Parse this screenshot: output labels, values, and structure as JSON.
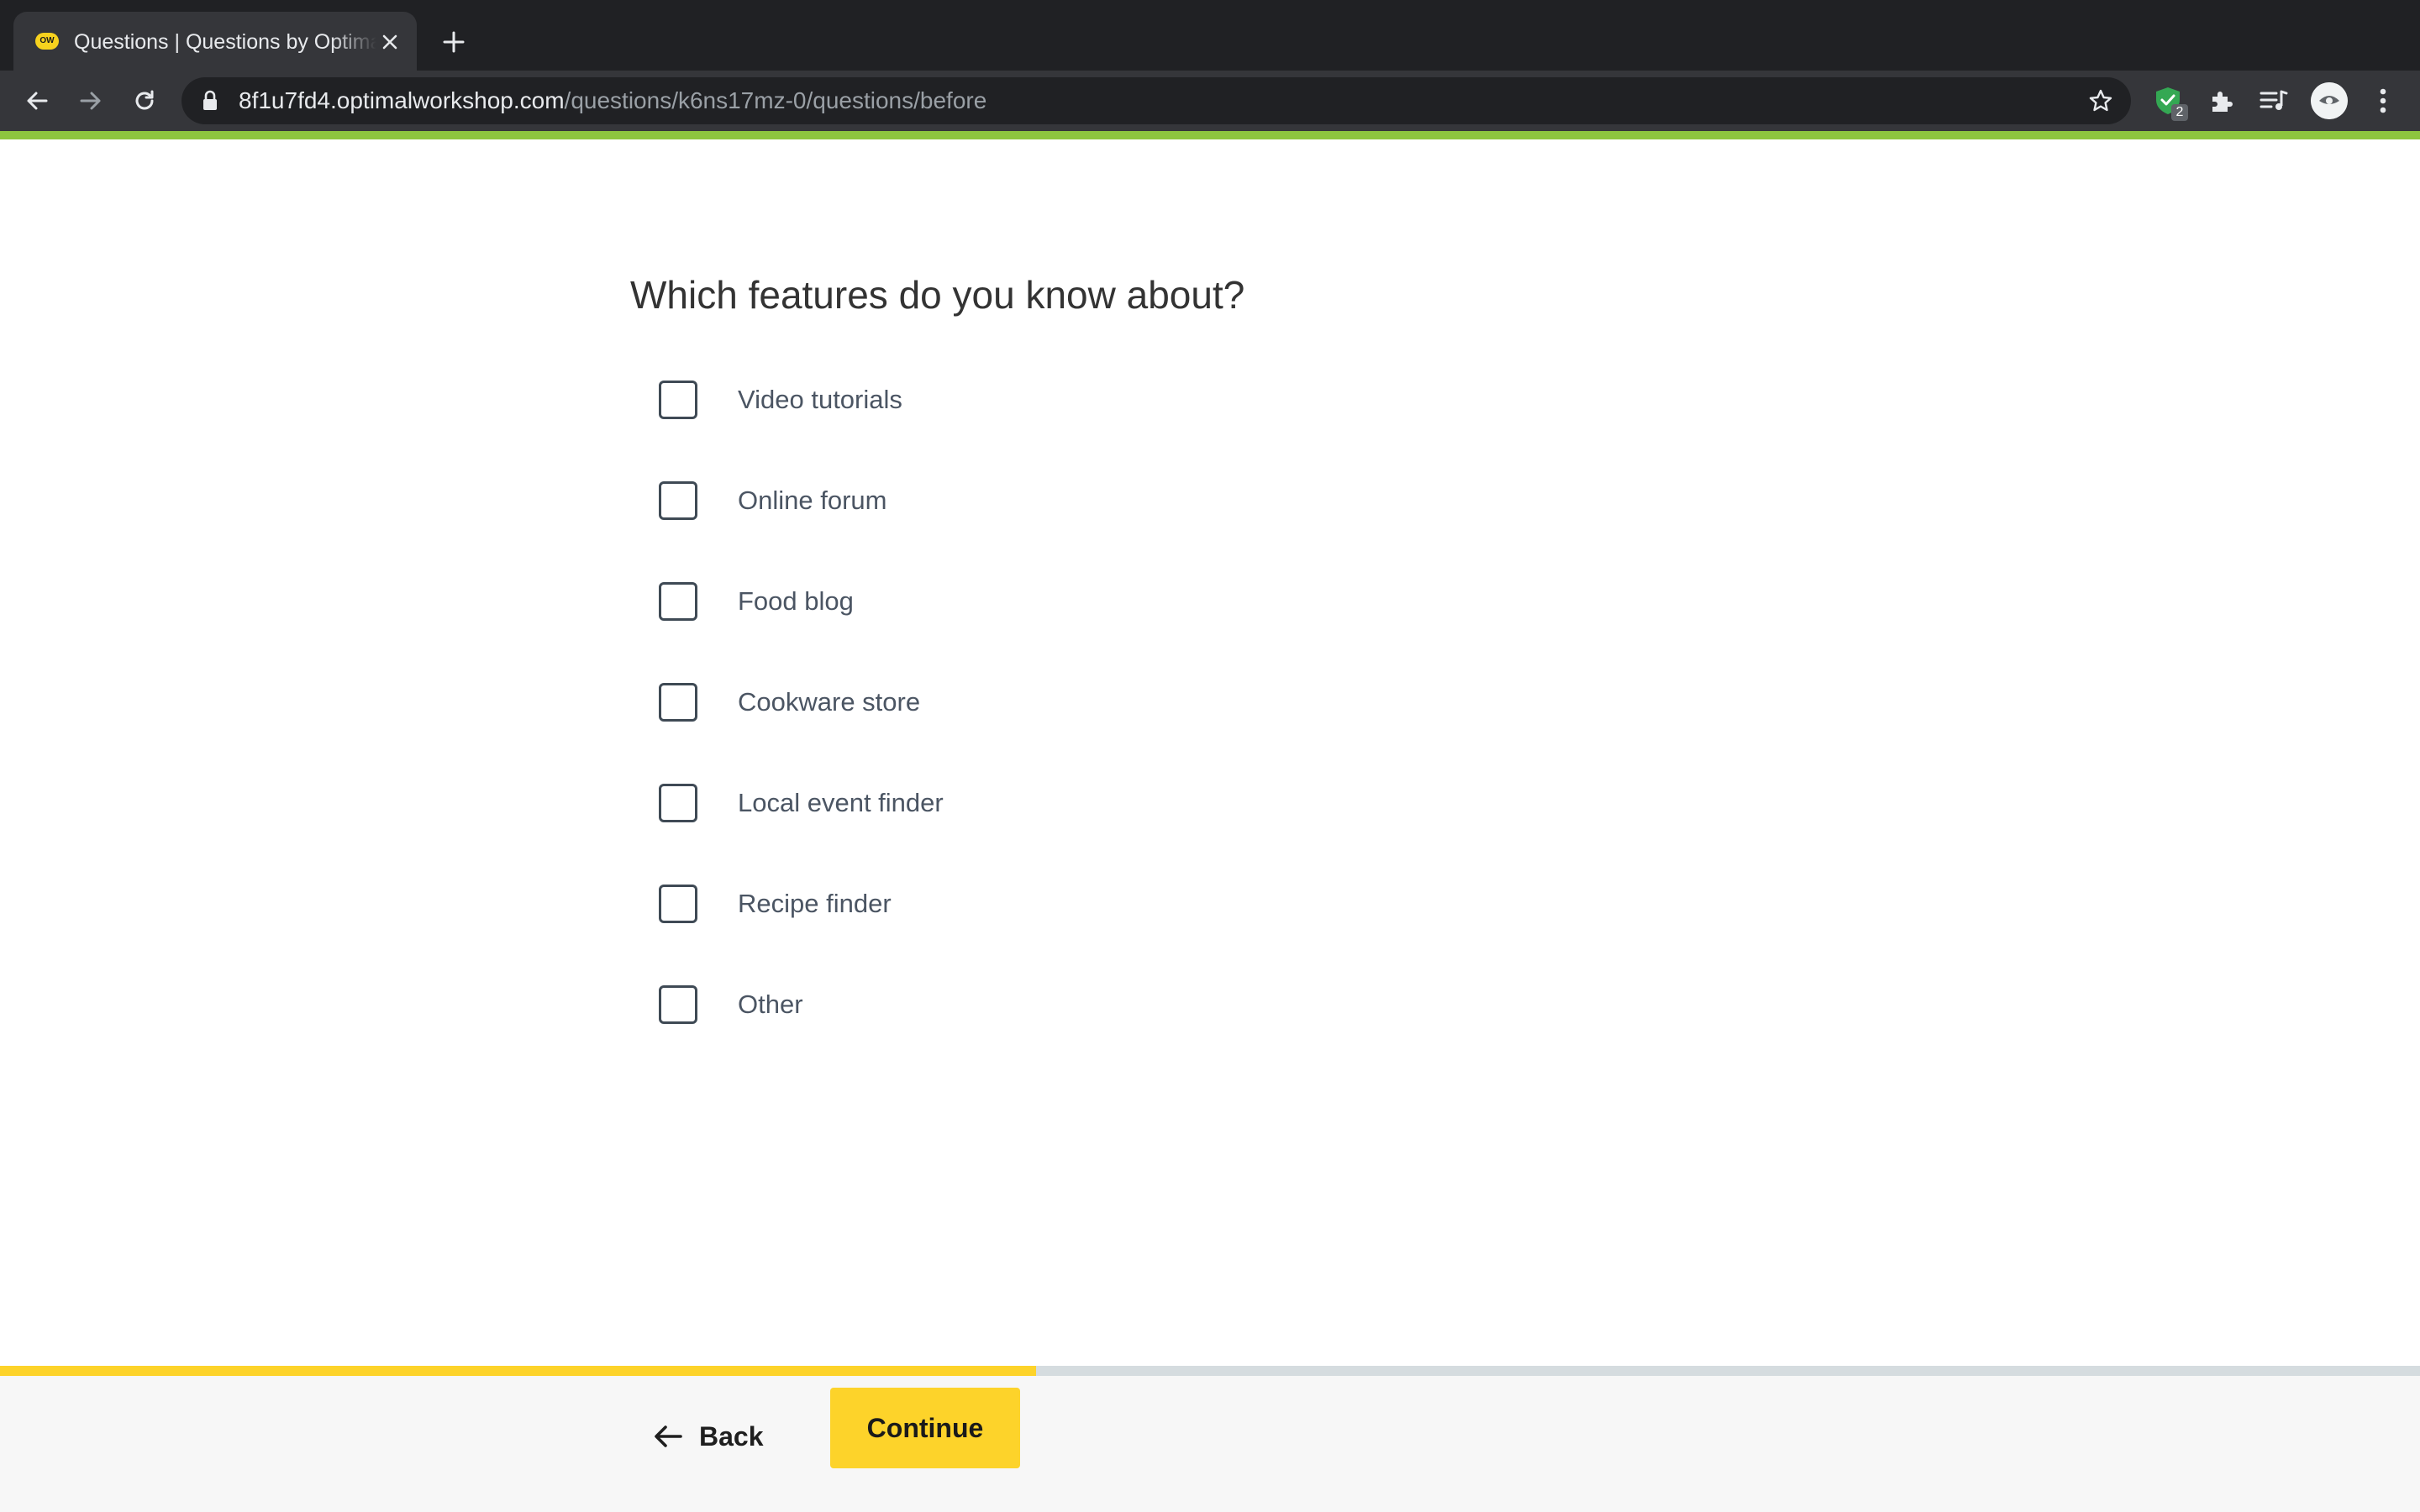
{
  "browser": {
    "tab_title": "Questions | Questions by Optimal Workshop",
    "favicon_text": "OW",
    "url_host": "8f1u7fd4.optimalworkshop.com",
    "url_path": "/questions/k6ns17mz-0/questions/before",
    "extension_badge": "2"
  },
  "question": {
    "text": "Which features do you know about?",
    "options": [
      {
        "label": "Video tutorials",
        "checked": false
      },
      {
        "label": "Online forum",
        "checked": false
      },
      {
        "label": "Food blog",
        "checked": false
      },
      {
        "label": "Cookware store",
        "checked": false
      },
      {
        "label": "Local event finder",
        "checked": false
      },
      {
        "label": "Recipe finder",
        "checked": false
      },
      {
        "label": "Other",
        "checked": false
      }
    ]
  },
  "progress": {
    "fraction": 0.428
  },
  "footer": {
    "back_label": "Back",
    "continue_label": "Continue"
  },
  "colors": {
    "accent_green": "#8dc63f",
    "brand_yellow": "#fdd32a",
    "progress_track": "#d5dcdf",
    "checkbox_border": "#3f4a55"
  }
}
